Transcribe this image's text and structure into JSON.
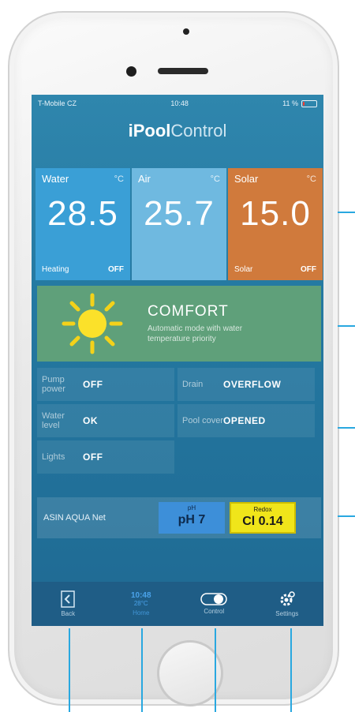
{
  "status_bar": {
    "carrier": "T-Mobile CZ",
    "time": "10:48",
    "battery_percent": "11 %",
    "battery_level": 0.11
  },
  "app": {
    "title_bold": "iPool",
    "title_light": "Control"
  },
  "tiles": [
    {
      "label": "Water",
      "unit": "°C",
      "value": "28.5",
      "foot_label": "Heating",
      "foot_status": "OFF",
      "color": "#3a9fd6"
    },
    {
      "label": "Air",
      "unit": "°C",
      "value": "25.7",
      "foot_label": "",
      "foot_status": "",
      "color": "#6fb9e0"
    },
    {
      "label": "Solar",
      "unit": "°C",
      "value": "15.0",
      "foot_label": "Solar",
      "foot_status": "OFF",
      "color": "#d07a3c"
    }
  ],
  "comfort": {
    "title": "COMFORT",
    "description": "Automatic mode with water temperature priority",
    "icon": "sun-icon"
  },
  "status": [
    {
      "label": "Pump power",
      "value": "OFF"
    },
    {
      "label": "Drain",
      "value": "OVERFLOW"
    },
    {
      "label": "Water level",
      "value": "OK"
    },
    {
      "label": "Pool cover",
      "value": "OPENED"
    },
    {
      "label": "Lights",
      "value": "OFF"
    }
  ],
  "probes": {
    "name": "ASIN AQUA Net",
    "ph": {
      "label": "pH",
      "value": "pH 7"
    },
    "redox": {
      "label": "Redox",
      "value": "Cl 0.14"
    }
  },
  "tabbar": {
    "back": {
      "label": "Back",
      "icon": "back-arrow-icon"
    },
    "home": {
      "time": "10:48",
      "temp": "28°C",
      "label": "Home"
    },
    "control": {
      "label": "Control",
      "icon": "toggle-icon"
    },
    "settings": {
      "label": "Settings",
      "icon": "gear-icon"
    }
  }
}
